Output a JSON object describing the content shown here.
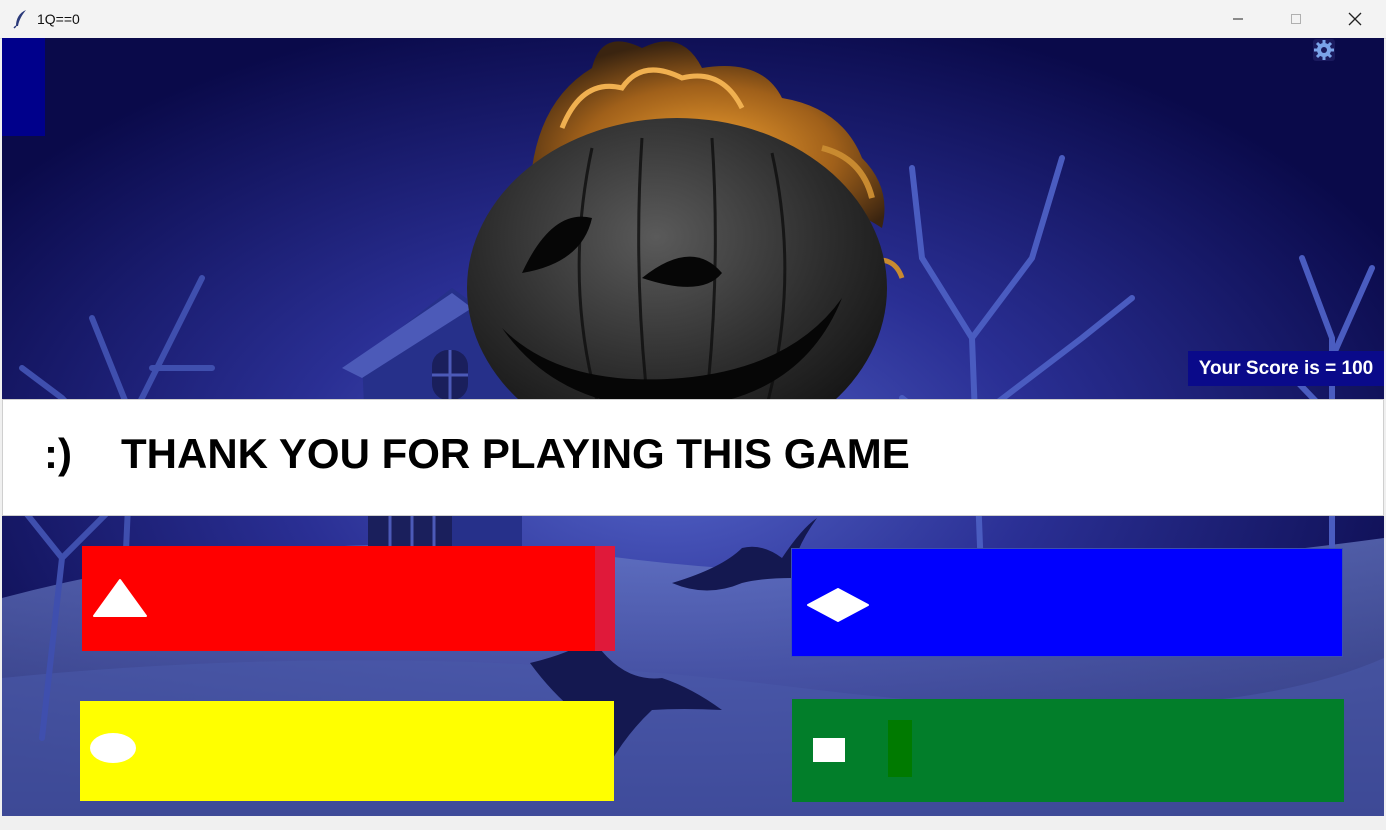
{
  "window": {
    "title": "1Q==0",
    "controls": [
      "minimize",
      "maximize",
      "close"
    ]
  },
  "game": {
    "score_label": "Your Score is = 100",
    "banner": {
      "smiley": ":)",
      "message": "THANK YOU FOR PLAYING THIS GAME"
    },
    "answers": [
      {
        "color": "#ff0000",
        "shape": "triangle-icon"
      },
      {
        "color": "#0000ff",
        "shape": "diamond-icon"
      },
      {
        "color": "#ffff00",
        "shape": "circle-icon"
      },
      {
        "color": "#027e2a",
        "shape": "square-icon"
      }
    ],
    "icons": {
      "settings": "gear-icon",
      "app": "feather-icon"
    },
    "colors": {
      "background": "#0b0b4e",
      "score_box": "#0a0a8a",
      "banner": "#ffffff"
    }
  }
}
